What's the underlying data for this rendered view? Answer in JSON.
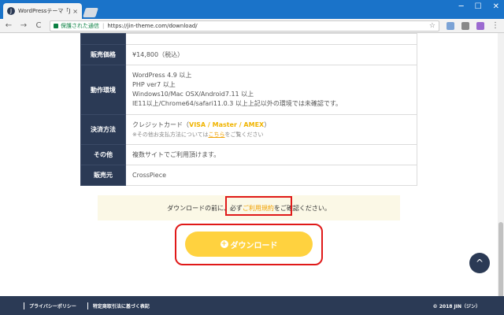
{
  "browser": {
    "tab_title": "WordPressテーマ「JIN」ダウ",
    "tab_favicon": "J",
    "tab_close": "×",
    "win_min": "─",
    "win_max": "☐",
    "win_close": "✕",
    "back": "←",
    "forward": "→",
    "reload": "C",
    "secure_label": "保護された通信",
    "url_sep": "|",
    "url": "https://jin-theme.com/download/",
    "star": "☆",
    "menu": "⋮",
    "ext_colors": [
      "#7ba3d6",
      "#888888",
      "#9b6ad0"
    ]
  },
  "spec_table": {
    "rows": [
      {
        "label": "販売価格",
        "value": "¥14,800（税込）"
      },
      {
        "label": "動作環境",
        "lines": [
          "WordPress 4.9 以上",
          "PHP ver7 以上",
          "Windows10/Mac OSX/Android7.11 以上",
          "IE11以上/Chrome64/safari11.0.3 以上上記以外の環境では未確認です。"
        ]
      },
      {
        "label": "決済方法",
        "prefix": "クレジットカード（",
        "highlight": "VISA / Master / AMEX",
        "suffix": "）",
        "note_prefix": "※その他お支払方法については",
        "note_link": "こちら",
        "note_suffix": "をご覧ください"
      },
      {
        "label": "その他",
        "value": "複数サイトでご利用頂けます。"
      },
      {
        "label": "販売元",
        "value": "CrossPiece"
      }
    ]
  },
  "notice": {
    "before": "ダウンロードの前に、必ず",
    "link": "ご利用規約",
    "after": "をご確認ください。"
  },
  "download_button": {
    "icon": "+",
    "label": "ダウンロード"
  },
  "to_top": "^",
  "footer": {
    "links": [
      "プライバシーポリシー",
      "特定商取引法に基づく表記"
    ],
    "copyright": "© 2018 JIN（ジン）"
  },
  "colors": {
    "navy": "#2b3a55",
    "accent": "#ffd23f",
    "highlight_red": "#e01919"
  }
}
